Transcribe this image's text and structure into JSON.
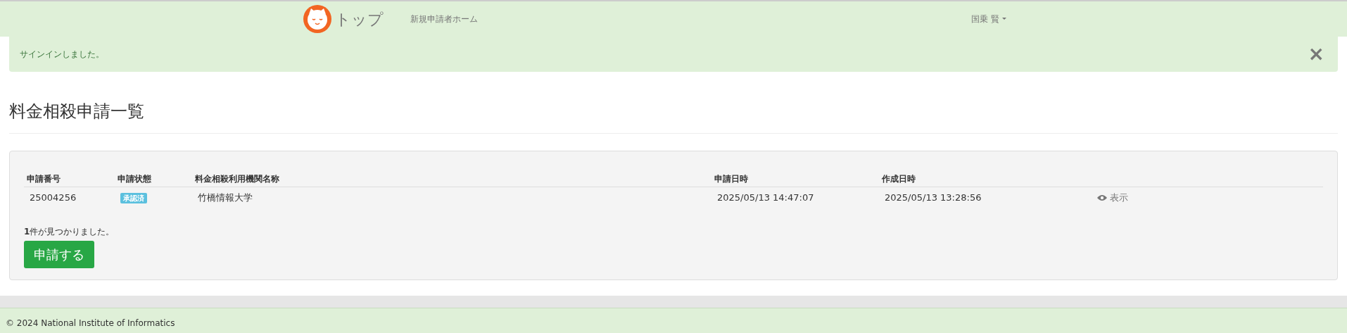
{
  "navbar": {
    "brand": "トップ",
    "links": [
      "新規申請者ホーム"
    ],
    "user": "国乗 賢"
  },
  "alert": {
    "message": "サインインしました。",
    "close": "×"
  },
  "page_title": "料金相殺申請一覧",
  "table": {
    "columns": [
      "申請番号",
      "申請状態",
      "料金相殺利用機関名称",
      "申請日時",
      "作成日時"
    ],
    "rows": [
      {
        "number": "25004256",
        "status": "承認済",
        "institution": "竹橋情報大学",
        "applied": "2025/05/13 14:47:07",
        "created": "2025/05/13 13:28:56",
        "action": "表示"
      }
    ]
  },
  "result_text": "**1**件が見つかりました。",
  "apply_button": "申請する",
  "footer": "© 2024 National Institute of Informatics"
}
